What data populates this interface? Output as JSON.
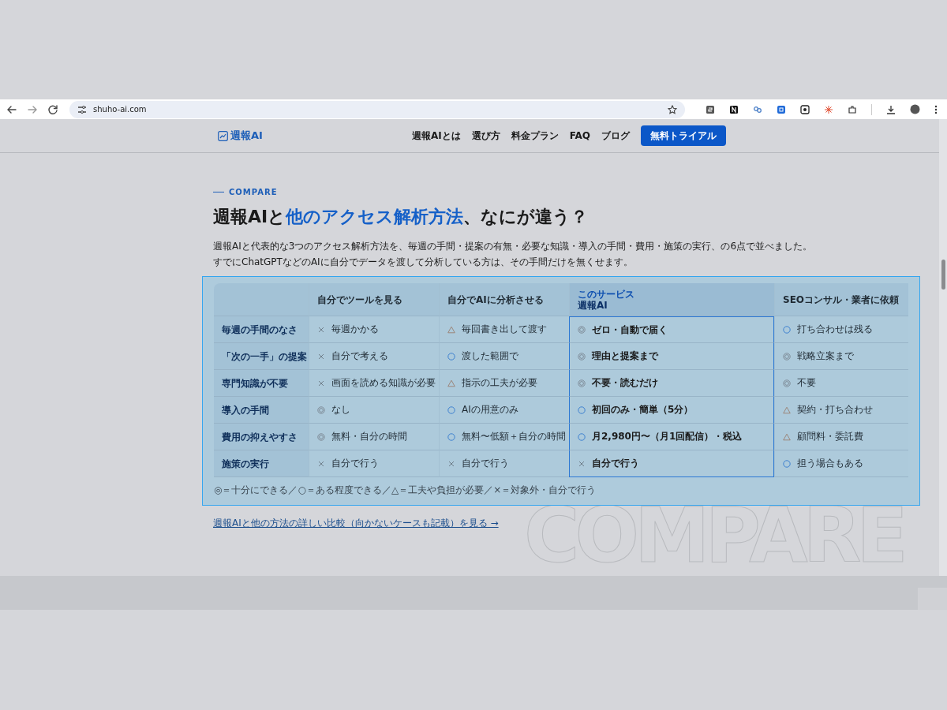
{
  "browser": {
    "url": "shuho-ai.com"
  },
  "header": {
    "logo": "週報AI",
    "nav": [
      "週報AIとは",
      "選び方",
      "料金プラン",
      "FAQ",
      "ブログ"
    ],
    "cta": "無料トライアル"
  },
  "section": {
    "eyebrow": "COMPARE",
    "title": [
      {
        "text": "週報AIと",
        "accent": false
      },
      {
        "text": "他のアクセス解析方法",
        "accent": true
      },
      {
        "text": "、なにが違う？",
        "accent": false
      }
    ],
    "intro": [
      "週報AIと代表的な3つのアクセス解析方法を、毎週の手間・提案の有無・必要な知識・導入の手間・費用・施策の実行、の6点で並べました。",
      "すでにChatGPTなどのAIに自分でデータを渡して分析している方は、その手間だけを無くせます。"
    ],
    "table": {
      "columns": [
        {
          "label": "自分でツールを見る",
          "featured": false
        },
        {
          "label": "自分でAIに分析させる",
          "featured": false
        },
        {
          "caption": "このサービス",
          "label": "週報AI",
          "featured": true
        },
        {
          "label": "SEOコンサル・業者に依頼",
          "featured": false
        }
      ],
      "rows": [
        {
          "label": "毎週の手間のなさ",
          "cells": [
            {
              "kind": "cross",
              "text": "毎週かかる"
            },
            {
              "kind": "triangle",
              "text": "毎回書き出して渡す"
            },
            {
              "kind": "double",
              "text": "ゼロ・自動で届く"
            },
            {
              "kind": "circle",
              "text": "打ち合わせは残る"
            }
          ]
        },
        {
          "label": "「次の一手」の提案",
          "cells": [
            {
              "kind": "cross",
              "text": "自分で考える"
            },
            {
              "kind": "circle",
              "text": "渡した範囲で"
            },
            {
              "kind": "double",
              "text": "理由と提案まで"
            },
            {
              "kind": "double",
              "text": "戦略立案まで"
            }
          ]
        },
        {
          "label": "専門知識が不要",
          "cells": [
            {
              "kind": "cross",
              "text": "画面を読める知識が必要"
            },
            {
              "kind": "triangle",
              "text": "指示の工夫が必要"
            },
            {
              "kind": "double",
              "text": "不要・読むだけ"
            },
            {
              "kind": "double",
              "text": "不要"
            }
          ]
        },
        {
          "label": "導入の手間",
          "cells": [
            {
              "kind": "double",
              "text": "なし"
            },
            {
              "kind": "circle",
              "text": "AIの用意のみ"
            },
            {
              "kind": "circle",
              "text": "初回のみ・簡単（5分）"
            },
            {
              "kind": "triangle",
              "text": "契約・打ち合わせ"
            }
          ]
        },
        {
          "label": "費用の抑えやすさ",
          "cells": [
            {
              "kind": "double",
              "text": "無料・自分の時間"
            },
            {
              "kind": "circle",
              "text": "無料〜低額＋自分の時間"
            },
            {
              "kind": "circle",
              "text": "月2,980円〜（月1回配信）・税込"
            },
            {
              "kind": "triangle",
              "text": "顧問料・委託費"
            }
          ]
        },
        {
          "label": "施策の実行",
          "cells": [
            {
              "kind": "cross",
              "text": "自分で行う"
            },
            {
              "kind": "cross",
              "text": "自分で行う"
            },
            {
              "kind": "cross",
              "text": "自分で行う"
            },
            {
              "kind": "circle",
              "text": "担う場合もある"
            }
          ]
        }
      ],
      "legend": "◎＝十分にできる／○＝ある程度できる／△＝工夫や負担が必要／×＝対象外・自分で行う"
    },
    "link": "週報AIと他の方法の詳しい比較（向かないケースも記載）を見る →",
    "watermark": "COMPARE"
  }
}
